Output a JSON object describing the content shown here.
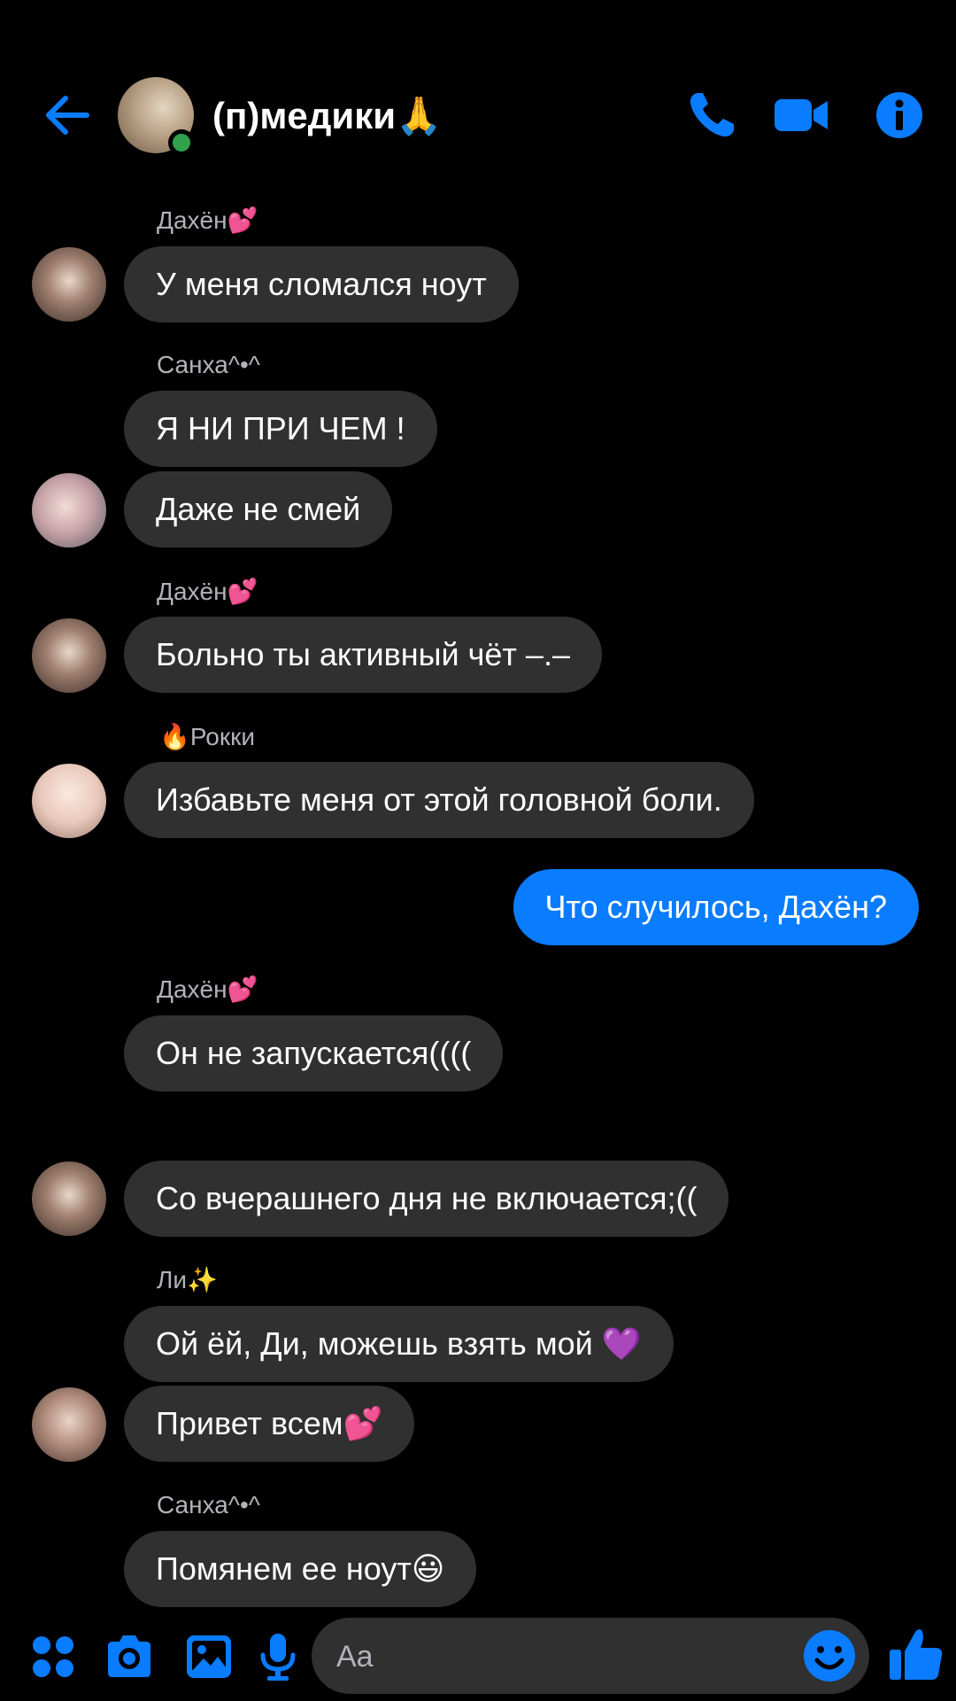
{
  "header": {
    "title": "(п)медики🙏",
    "back_icon": "arrow-left-icon",
    "call_icon": "phone-icon",
    "video_icon": "video-camera-icon",
    "info_icon": "info-icon",
    "accent_color": "#0a7cff",
    "online_status_color": "#31a24c"
  },
  "messages": [
    {
      "sender": "Дахён💕",
      "text": "У меня сломался ноут"
    },
    {
      "sender": "Санха^•^",
      "text": "Я НИ ПРИ ЧЕМ !"
    },
    {
      "text": "Даже не смей"
    },
    {
      "sender": "Дахён💕",
      "text": "Больно ты активный чёт –.–"
    },
    {
      "sender": "🔥Рокки",
      "text": "Избавьте меня от этой головной боли."
    },
    {
      "outgoing": true,
      "text": "Что случилось, Дахён?"
    },
    {
      "sender": "Дахён💕",
      "text": "Он не запускается(((("
    },
    {
      "text": "Со вчерашнего дня не включается;(("
    },
    {
      "sender": "Ли✨",
      "text": "Ой ёй, Ди, можешь взять мой 💜"
    },
    {
      "text": "Привет всем💕"
    },
    {
      "sender": "Санха^•^",
      "text": "Помянем ее ноут😃"
    }
  ],
  "composer": {
    "placeholder": "Aa",
    "apps_icon": "grid-apps-icon",
    "camera_icon": "camera-icon",
    "gallery_icon": "image-icon",
    "mic_icon": "microphone-icon",
    "emoji_icon": "smiley-icon",
    "like_icon": "thumbs-up-icon"
  },
  "colors": {
    "background": "#000000",
    "incoming_bubble": "#303030",
    "outgoing_bubble": "#0a7cff",
    "sender_label": "#b0b3b8"
  }
}
